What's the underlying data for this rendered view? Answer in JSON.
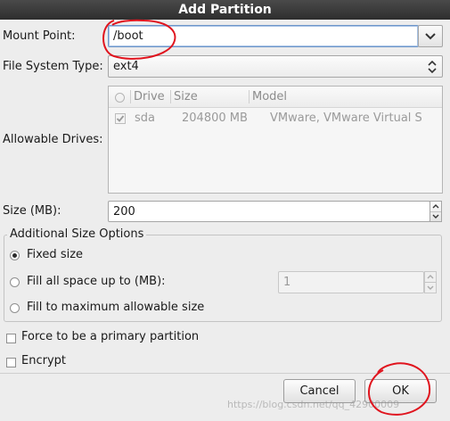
{
  "window": {
    "title": "Add Partition"
  },
  "mount_point": {
    "label": "Mount Point:",
    "value": "/boot"
  },
  "file_system_type": {
    "label": "File System Type:",
    "value": "ext4"
  },
  "allowable_drives": {
    "label": "Allowable Drives:",
    "columns": [
      "Drive",
      "Size",
      "Model"
    ],
    "rows": [
      {
        "checked": true,
        "drive": "sda",
        "size": "204800 MB",
        "model": "VMware, VMware Virtual S"
      }
    ]
  },
  "size": {
    "label": "Size (MB):",
    "value": "200"
  },
  "additional_size_options": {
    "title": "Additional Size Options",
    "fixed_size": {
      "label": "Fixed size",
      "selected": true
    },
    "fill_up_to": {
      "label": "Fill all space up to (MB):",
      "value": "1",
      "selected": false
    },
    "fill_max": {
      "label": "Fill to maximum allowable size",
      "selected": false
    }
  },
  "options": {
    "primary_partition": {
      "label": "Force to be a primary partition",
      "checked": false
    },
    "encrypt": {
      "label": "Encrypt",
      "checked": false
    }
  },
  "buttons": {
    "cancel": "Cancel",
    "ok": "OK"
  },
  "watermark": "https://blog.csdn.net/qq_42900009",
  "annotation": {
    "color": "#e0141e"
  }
}
